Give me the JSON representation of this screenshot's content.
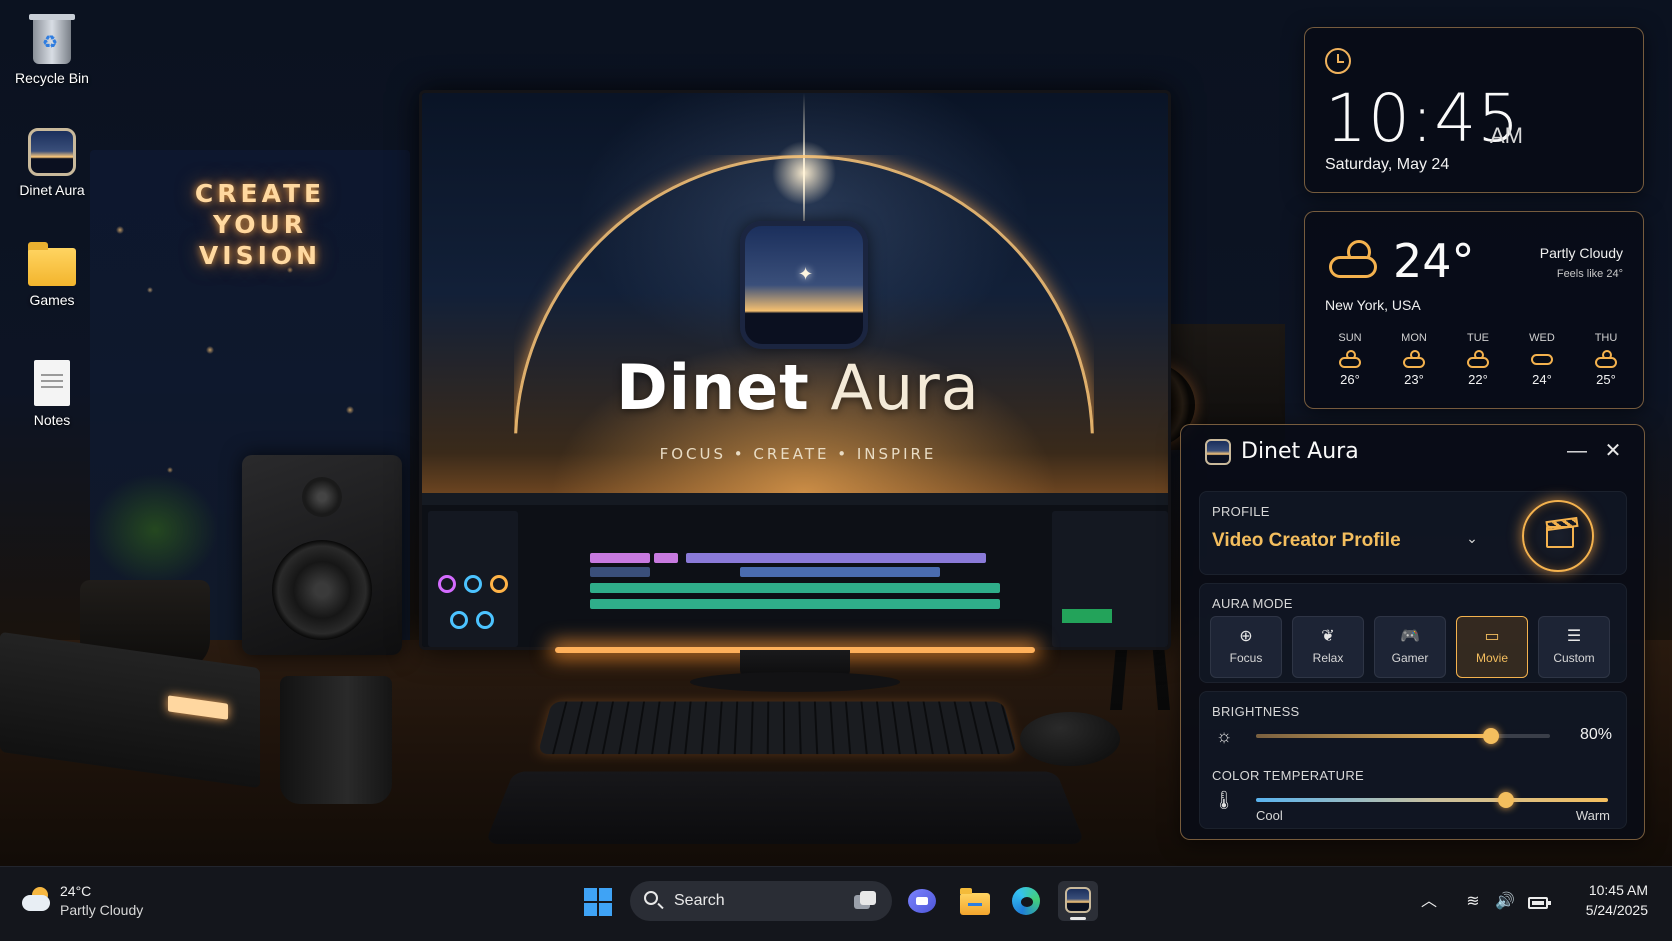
{
  "desktop": {
    "neon_sign": "CREATE YOUR VISION",
    "icons": [
      {
        "label": "Recycle Bin",
        "icon": "recycle-bin-icon"
      },
      {
        "label": "Dinet Aura",
        "icon": "dinet-aura-app-icon"
      },
      {
        "label": "Games",
        "icon": "folder-icon"
      },
      {
        "label": "Notes",
        "icon": "notes-file-icon"
      }
    ]
  },
  "monitor": {
    "brand_bold": "Dinet",
    "brand_light": " Aura",
    "tagline": "FOCUS • CREATE • INSPIRE"
  },
  "clock_widget": {
    "time": "10:45",
    "ampm": "AM",
    "date": "Saturday, May 24"
  },
  "weather_widget": {
    "temp": "24°",
    "condition": "Partly Cloudy",
    "feels_like": "Feels like 24°",
    "location": "New York, USA",
    "forecast": [
      {
        "day": "SUN",
        "temp": "26°"
      },
      {
        "day": "MON",
        "temp": "23°"
      },
      {
        "day": "TUE",
        "temp": "22°"
      },
      {
        "day": "WED",
        "temp": "24°"
      },
      {
        "day": "THU",
        "temp": "25°"
      }
    ]
  },
  "aura_panel": {
    "title_bold": "Dinet",
    "title_light": " Aura",
    "minimize": "—",
    "close": "✕",
    "profile_label": "PROFILE",
    "profile_value": "Video Creator Profile",
    "mode_label": "AURA MODE",
    "modes": [
      {
        "label": "Focus",
        "icon": "focus-icon",
        "glyph": "⊕"
      },
      {
        "label": "Relax",
        "icon": "leaf-icon",
        "glyph": "❦"
      },
      {
        "label": "Gamer",
        "icon": "gamepad-icon",
        "glyph": "🎮"
      },
      {
        "label": "Movie",
        "icon": "monitor-icon",
        "glyph": "▭"
      },
      {
        "label": "Custom",
        "icon": "sliders-icon",
        "glyph": "☰"
      }
    ],
    "active_mode": "Movie",
    "brightness_label": "BRIGHTNESS",
    "brightness_value": 0.8,
    "brightness_text": "80%",
    "color_temp_label": "COLOR TEMPERATURE",
    "color_temp_value": 0.71,
    "cool_label": "Cool",
    "warm_label": "Warm",
    "accent_color": "#f4be5e"
  },
  "taskbar": {
    "weather_temp": "24°C",
    "weather_cond": "Partly Cloudy",
    "search_placeholder": "Search",
    "time": "10:45 AM",
    "date": "5/24/2025"
  }
}
